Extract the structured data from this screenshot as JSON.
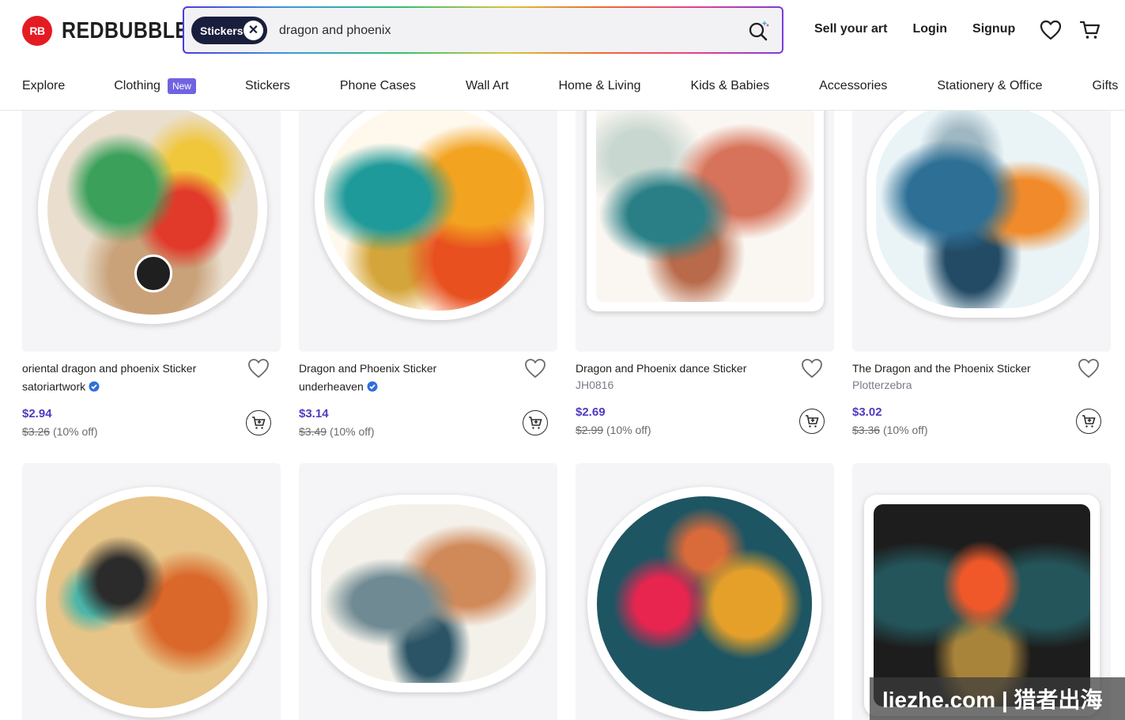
{
  "brand": {
    "logo_mark": "RB",
    "name": "REDBUBBLE",
    "color": "#e51b23"
  },
  "search": {
    "chip_label": "Stickers",
    "query": "dragon and phoenix"
  },
  "header_links": {
    "sell": "Sell your art",
    "login": "Login",
    "signup": "Signup"
  },
  "icons": {
    "favorites": "heart-icon",
    "cart": "cart-icon",
    "search": "search-icon"
  },
  "categories": [
    {
      "label": "Explore"
    },
    {
      "label": "Clothing",
      "badge": "New"
    },
    {
      "label": "Stickers"
    },
    {
      "label": "Phone Cases"
    },
    {
      "label": "Wall Art"
    },
    {
      "label": "Home & Living"
    },
    {
      "label": "Kids & Babies"
    },
    {
      "label": "Accessories"
    },
    {
      "label": "Stationery & Office"
    },
    {
      "label": "Gifts"
    }
  ],
  "products": [
    {
      "title": "oriental dragon and phoenix Sticker",
      "artist": "satoriartwork",
      "verified": true,
      "price": "$2.94",
      "was": "$3.26",
      "discount": "(10% off)"
    },
    {
      "title": "Dragon and Phoenix Sticker",
      "artist": "underheaven",
      "verified": true,
      "price": "$3.14",
      "was": "$3.49",
      "discount": "(10% off)"
    },
    {
      "title": "Dragon and Phoenix dance Sticker",
      "artist": "JH0816",
      "verified": false,
      "price": "$2.69",
      "was": "$2.99",
      "discount": "(10% off)"
    },
    {
      "title": "The Dragon and the Phoenix Sticker",
      "artist": "Plotterzebra",
      "verified": false,
      "price": "$3.02",
      "was": "$3.36",
      "discount": "(10% off)"
    }
  ],
  "colors": {
    "accent": "#4e3bbf",
    "new_badge": "#7063df",
    "chip": "#1a1e3d"
  },
  "watermark": "liezhe.com | 猎者出海"
}
